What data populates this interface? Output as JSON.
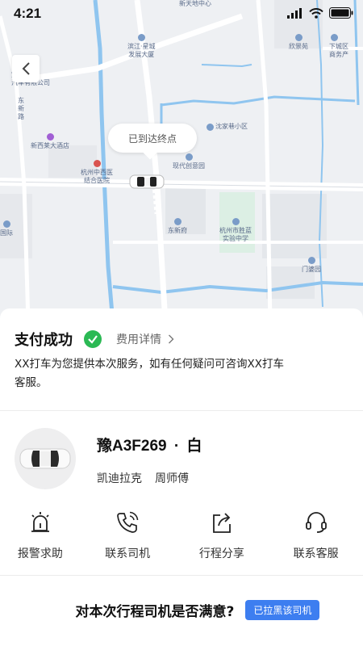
{
  "status_bar": {
    "time": "4:21"
  },
  "map": {
    "pois": {
      "xintiandi": "新天地中心",
      "binjiang": "滨江·星城\n发展大厦",
      "xinjingyuan": "欣景苑",
      "xiacheng": "下城区\n商务产",
      "baotong": "宝通\n汽车有限公司",
      "dongxin": "东\n新\n路",
      "xixilai": "新西莱大酒店",
      "shenjiaxiang": "沈家巷小区",
      "hangzhou_hospital": "杭州中西医\n结合医院",
      "xiandai": "现代创意园",
      "dongxinfu": "东新府",
      "shenglan": "杭州市胜蓝\n实验中学",
      "guoji": "国际",
      "menpoyuan": "门婆园"
    },
    "bubble_text": "已到达终点"
  },
  "payment": {
    "title": "支付成功",
    "fee_link": "费用详情",
    "description": "XX打车为您提供本次服务，如有任何疑问可咨询XX打车客服。"
  },
  "driver": {
    "plate": "豫A3F269",
    "separator": "·",
    "car_color": "白",
    "car_model": "凯迪拉克",
    "driver_name": "周师傅"
  },
  "actions": [
    {
      "label": "报警求助",
      "icon": "alarm-icon"
    },
    {
      "label": "联系司机",
      "icon": "phone-icon"
    },
    {
      "label": "行程分享",
      "icon": "share-icon"
    },
    {
      "label": "联系客服",
      "icon": "headset-icon"
    }
  ],
  "rating": {
    "question": "对本次行程司机是否满意?",
    "blacklist_button": "已拉黑该司机"
  },
  "colors": {
    "accent": "#3d7ef0",
    "success": "#2bb954",
    "water": "#8fc5ef"
  }
}
